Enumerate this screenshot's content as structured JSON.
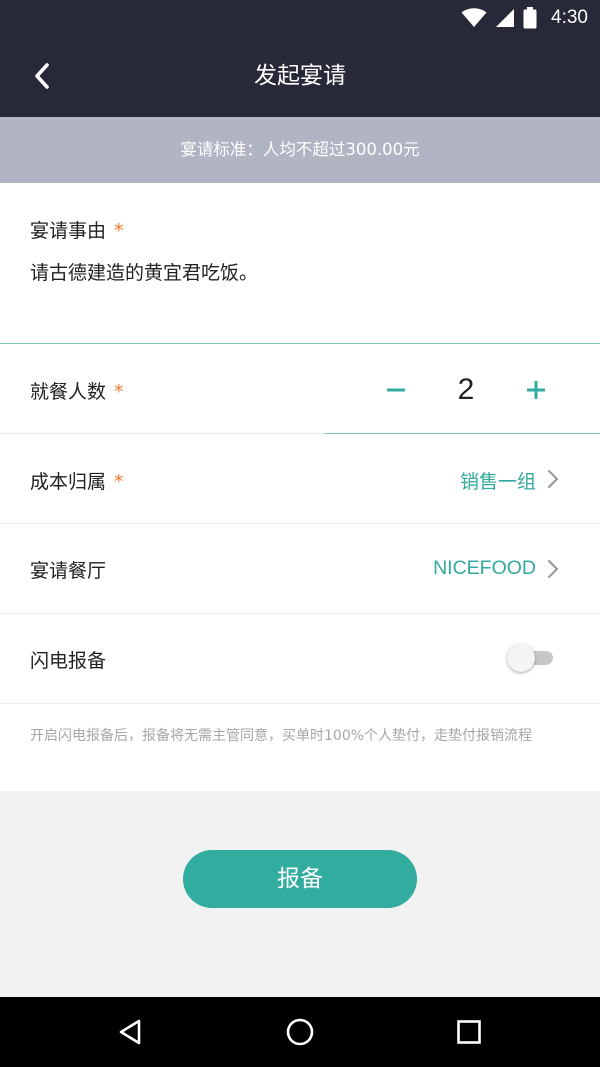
{
  "status_bar": {
    "time": "4:30",
    "icons": [
      "wifi-icon",
      "signal-icon",
      "battery-icon"
    ]
  },
  "header": {
    "title": "发起宴请",
    "back_icon": "chevron-left-icon"
  },
  "notice": {
    "text": "宴请标准：人均不超过300.00元"
  },
  "form": {
    "required_mark": "*",
    "reason": {
      "label": "宴请事由",
      "value": "请古德建造的黄宜君吃饭。"
    },
    "diners": {
      "label": "就餐人数",
      "value": "2"
    },
    "cost_center": {
      "label": "成本归属",
      "value": "销售一组"
    },
    "restaurant": {
      "label": "宴请餐厅",
      "value": "NICEFOOD"
    },
    "flash_report": {
      "label": "闪电报备",
      "enabled": false,
      "hint": "开启闪电报备后，报备将无需主管同意，买单时100%个人垫付，走垫付报销流程"
    }
  },
  "actions": {
    "submit_label": "报备"
  },
  "colors": {
    "header_bg": "#272838",
    "notice_bg": "#b1b4c3",
    "accent": "#33aca0",
    "required": "#ee7a2c"
  },
  "nav_bar": {
    "buttons": [
      "back-triangle-icon",
      "home-circle-icon",
      "recents-square-icon"
    ]
  }
}
